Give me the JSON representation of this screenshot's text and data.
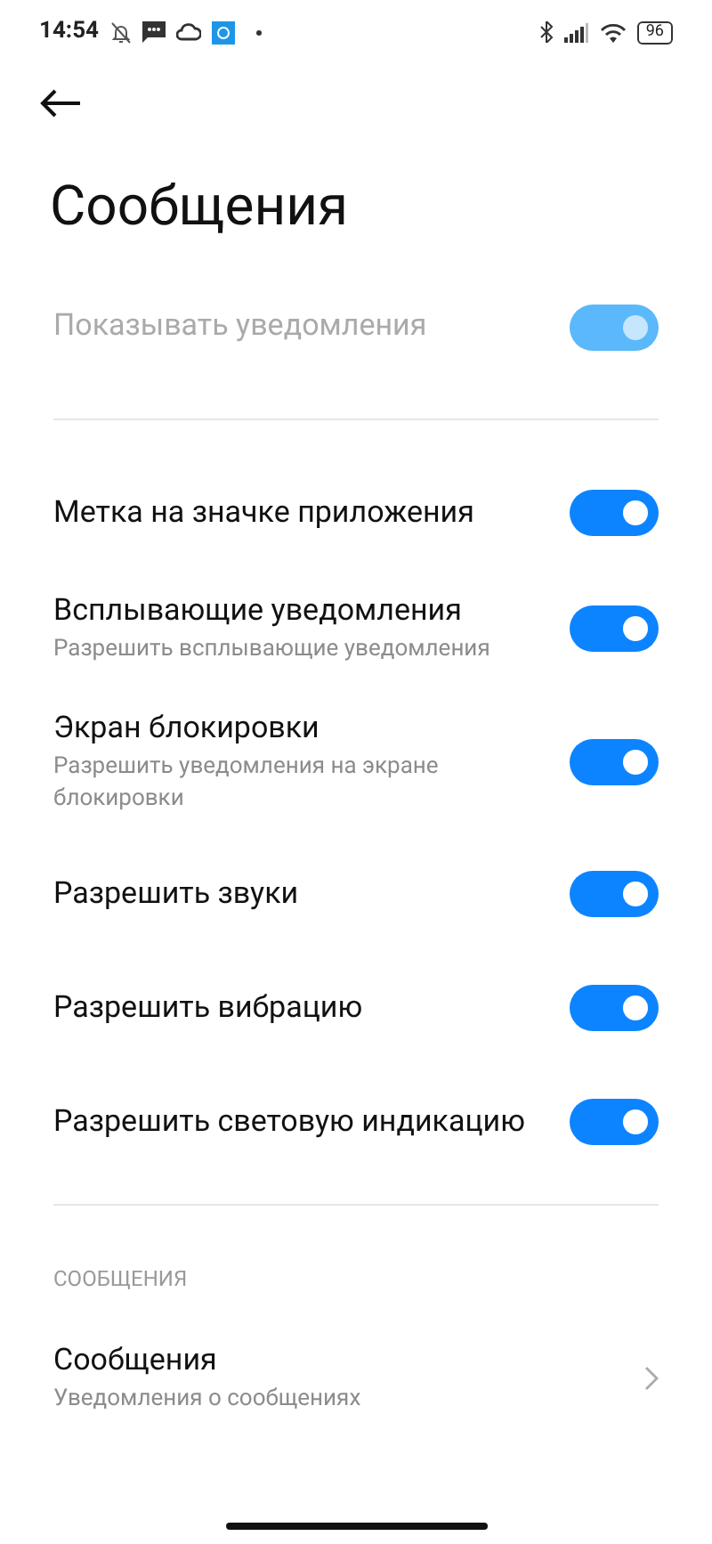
{
  "status_bar": {
    "time": "14:54",
    "battery": "96"
  },
  "title": "Сообщения",
  "master": {
    "label": "Показывать уведомления",
    "on": true,
    "disabled": true
  },
  "settings": [
    {
      "title": "Метка на значке приложения",
      "on": true
    },
    {
      "title": "Всплывающие уведомления",
      "subtitle": "Разрешить всплывающие уведомления",
      "on": true
    },
    {
      "title": "Экран блокировки",
      "subtitle": "Разрешить уведомления на экране блокировки",
      "on": true
    },
    {
      "title": "Разрешить звуки",
      "on": true
    },
    {
      "title": "Разрешить вибрацию",
      "on": true
    },
    {
      "title": "Разрешить световую индикацию",
      "on": true
    }
  ],
  "section": {
    "header": "СООБЩЕНИЯ",
    "items": [
      {
        "title": "Сообщения",
        "subtitle": "Уведомления о сообщениях"
      }
    ]
  }
}
